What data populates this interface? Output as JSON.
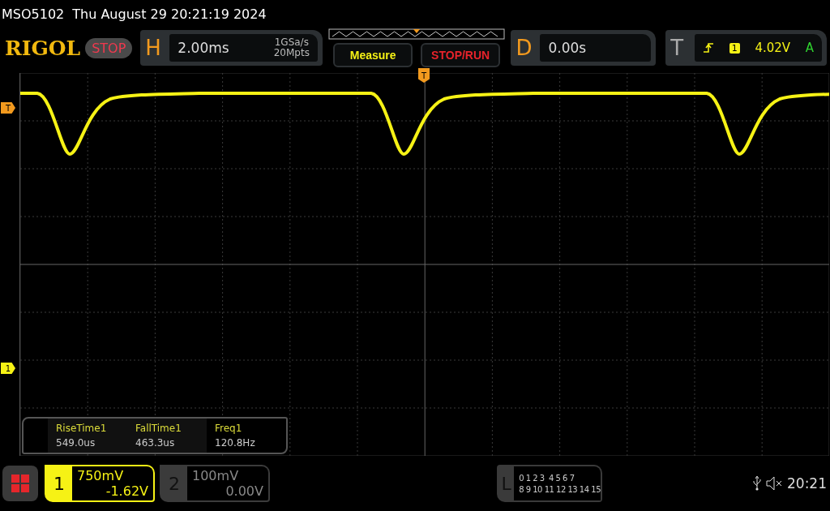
{
  "title": {
    "model": "MSO5102",
    "datetime": "Thu August 29 20:21:19 2024"
  },
  "logo": "RIGOL",
  "run_state": "STOP",
  "horizontal": {
    "label": "H",
    "timebase": "2.00ms",
    "sample_rate": "1GSa/s",
    "memory_depth": "20Mpts"
  },
  "buttons": [
    {
      "label": "Measure",
      "kind": "measure"
    },
    {
      "label": "STOP/RUN",
      "kind": "runstop"
    }
  ],
  "delay": {
    "label": "D",
    "value": "0.00s"
  },
  "trigger": {
    "label": "T",
    "source": "1",
    "level": "4.02V",
    "mode": "A"
  },
  "markers": {
    "trigger_level": "T",
    "channel": "1",
    "trigger_position": "T"
  },
  "measurements": [
    {
      "name": "RiseTime1",
      "value": "549.0us"
    },
    {
      "name": "FallTime1",
      "value": "463.3us"
    },
    {
      "name": "Freq1",
      "value": "120.8Hz"
    }
  ],
  "channels": [
    {
      "number": "1",
      "scale": "750mV",
      "offset": "-1.62V",
      "selected": true
    },
    {
      "number": "2",
      "scale": "100mV",
      "offset": "0.00V",
      "selected": false
    }
  ],
  "logic": {
    "label": "L",
    "rows": [
      "0 1 2 3  4 5 6 7",
      "8 9 10 11 12 13 14 15"
    ]
  },
  "clock": "20:21"
}
